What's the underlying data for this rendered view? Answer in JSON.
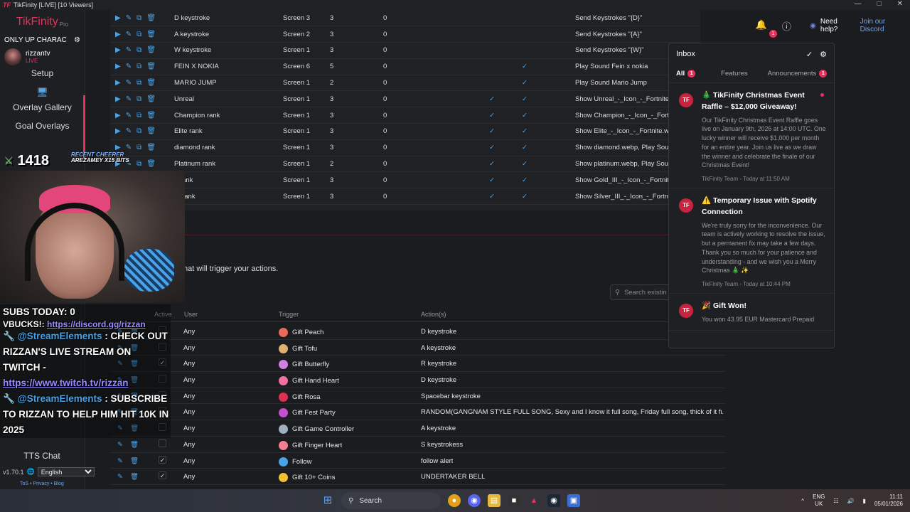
{
  "window": {
    "title": "TikFinity [LIVE] [10 Viewers]",
    "logo": "TF"
  },
  "sidebar": {
    "brand": "TikFinity",
    "brand_suffix": "Pro",
    "account_select": "ONLY UP CHARAC",
    "user": {
      "name": "rizzantv",
      "status": "LIVE"
    },
    "items": [
      "Setup",
      "Overlay Gallery",
      "Goal Overlays",
      "TTS Chat"
    ],
    "version": "v1.70.1",
    "language": "English",
    "legal": [
      "ToS",
      "Privacy",
      "Blog"
    ]
  },
  "actions_table": {
    "rows": [
      {
        "name": "D keystroke",
        "screen": "Screen 3",
        "dur": "3",
        "pts": "0",
        "c1": false,
        "c2": false,
        "desc": "Send Keystrokes \"{D}\""
      },
      {
        "name": "A keystroke",
        "screen": "Screen 2",
        "dur": "3",
        "pts": "0",
        "c1": false,
        "c2": false,
        "desc": "Send Keystrokes \"{A}\""
      },
      {
        "name": "W keystroke",
        "screen": "Screen 1",
        "dur": "3",
        "pts": "0",
        "c1": false,
        "c2": false,
        "desc": "Send Keystrokes \"{W}\""
      },
      {
        "name": "FEIN X NOKIA",
        "screen": "Screen 6",
        "dur": "5",
        "pts": "0",
        "c1": false,
        "c2": true,
        "desc": "Play Sound Fein x nokia"
      },
      {
        "name": "MARIO JUMP",
        "screen": "Screen 1",
        "dur": "2",
        "pts": "0",
        "c1": false,
        "c2": true,
        "desc": "Play Sound Mario Jump"
      },
      {
        "name": "Unreal",
        "screen": "Screen 1",
        "dur": "3",
        "pts": "0",
        "c1": true,
        "c2": true,
        "desc": "Show Unreal_-_Icon_-_Fortnite.webp"
      },
      {
        "name": "Champion rank",
        "screen": "Screen 1",
        "dur": "3",
        "pts": "0",
        "c1": true,
        "c2": true,
        "desc": "Show Champion_-_Icon_-_Fortnite.w"
      },
      {
        "name": "Elite rank",
        "screen": "Screen 1",
        "dur": "3",
        "pts": "0",
        "c1": true,
        "c2": true,
        "desc": "Show Elite_-_Icon_-_Fortnite.webp, P"
      },
      {
        "name": "diamond rank",
        "screen": "Screen 1",
        "dur": "3",
        "pts": "0",
        "c1": true,
        "c2": true,
        "desc": "Show diamond.webp, Play Sound Yi"
      },
      {
        "name": "Platinum rank",
        "screen": "Screen 1",
        "dur": "2",
        "pts": "0",
        "c1": true,
        "c2": true,
        "desc": "Show platinum.webp, Play Sound Vi"
      },
      {
        "name": "d rank",
        "screen": "Screen 1",
        "dur": "3",
        "pts": "0",
        "c1": true,
        "c2": true,
        "desc": "Show Gold_III_-_Icon_-_Fortnite.web"
      },
      {
        "name": "er rank",
        "screen": "Screen 1",
        "dur": "3",
        "pts": "0",
        "c1": true,
        "c2": true,
        "desc": "Show Silver_III_-_Icon_-_Fortnite.web"
      }
    ]
  },
  "events": {
    "hint": "hat will trigger your actions.",
    "search_placeholder": "Search existin",
    "columns": {
      "active": "Active",
      "user": "User",
      "trigger": "Trigger",
      "actions": "Action(s)"
    },
    "rows": [
      {
        "user": "Any",
        "trigger": "Gift Peach",
        "action": "D keystroke",
        "color": "#e86a5a",
        "active": false
      },
      {
        "user": "Any",
        "trigger": "Gift Tofu",
        "action": "A keystroke",
        "color": "#e0b070",
        "active": false
      },
      {
        "user": "Any",
        "trigger": "Gift Butterfly",
        "action": "R keystroke",
        "color": "#d080e0",
        "active": true
      },
      {
        "user": "Any",
        "trigger": "Gift Hand Heart",
        "action": "D keystroke",
        "color": "#f070a0",
        "active": false
      },
      {
        "user": "Any",
        "trigger": "Gift Rosa",
        "action": "Spacebar keystroke",
        "color": "#e03050",
        "active": false
      },
      {
        "user": "Any",
        "trigger": "Gift Fest Party",
        "action": "RANDOM(GANGNAM STYLE FULL SONG, Sexy and I know it full song, Friday full song, thick of it full ...",
        "color": "#c050d0",
        "active": false
      },
      {
        "user": "Any",
        "trigger": "Gift Game Controller",
        "action": "A keystroke",
        "color": "#a0b0c0",
        "active": false
      },
      {
        "user": "Any",
        "trigger": "Gift Finger Heart",
        "action": "S keystrokess",
        "color": "#f08090",
        "active": false
      },
      {
        "user": "Any",
        "trigger": "Follow",
        "action": "follow alert",
        "color": "#4aa3e6",
        "active": true
      },
      {
        "user": "Any",
        "trigger": "Gift 10+ Coins",
        "action": "UNDERTAKER BELL",
        "color": "#f0c030",
        "active": true
      }
    ]
  },
  "topbar": {
    "help_text": "Need help?",
    "discord_link": "Join our Discord",
    "bell_badge": "1"
  },
  "inbox": {
    "title": "Inbox",
    "tabs": [
      {
        "label": "All",
        "count": "1"
      },
      {
        "label": "Features",
        "count": ""
      },
      {
        "label": "Announcements",
        "count": "1"
      }
    ],
    "notifications": [
      {
        "title": "🎄 TikFinity Christmas Event Raffle – $12,000 Giveaway!",
        "body": "Our TikFinity Christmas Event Raffle goes live on January 9th, 2026 at 14:00 UTC. One lucky winner will receive $1,000 per month for an entire year. Join us live as we draw the winner and celebrate the finale of our Christmas Event!",
        "meta": "TikFinity Team - Today at 11:50 AM",
        "unread": true
      },
      {
        "title": "⚠️ Temporary Issue with Spotify Connection",
        "body": "We're truly sorry for the inconvenience. Our team is actively working to resolve the issue, but a permanent fix may take a few days. Thank you so much for your patience and understanding - and we wish you a Merry Christmas 🎄 ✨",
        "meta": "TikFinity Team - Today at 10:44 PM",
        "unread": false
      },
      {
        "title": "🎉 Gift Won!",
        "body": "You won 43.95 EUR Mastercard Prepaid",
        "meta": "",
        "unread": false
      }
    ]
  },
  "stream_overlay": {
    "counter": "1418",
    "recent_cheerer_label": "RECENT CHEERER",
    "recent_cheerer": "AREZAMEY X15 BITS",
    "subs_today": "SUBS TODAY: 0",
    "lines": [
      {
        "prefix": "",
        "text": "VBUCKS!: ",
        "link": "https://discord.gg/rizzan"
      },
      {
        "prefix": "@StreamElements",
        "text": ": CHECK OUT RIZZAN'S LIVE STREAM ON TWITCH -",
        "link": "https://www.twitch.tv/rizzan"
      },
      {
        "prefix": "@StreamElements",
        "text": ": SUBSCRIBE TO RIZZAN TO HELP HIM HIT 10K IN 2025",
        "link": ""
      }
    ]
  },
  "taskbar": {
    "search": "Search",
    "lang_1": "ENG",
    "lang_2": "UK",
    "time": "11:11",
    "date": "05/01/2026"
  }
}
